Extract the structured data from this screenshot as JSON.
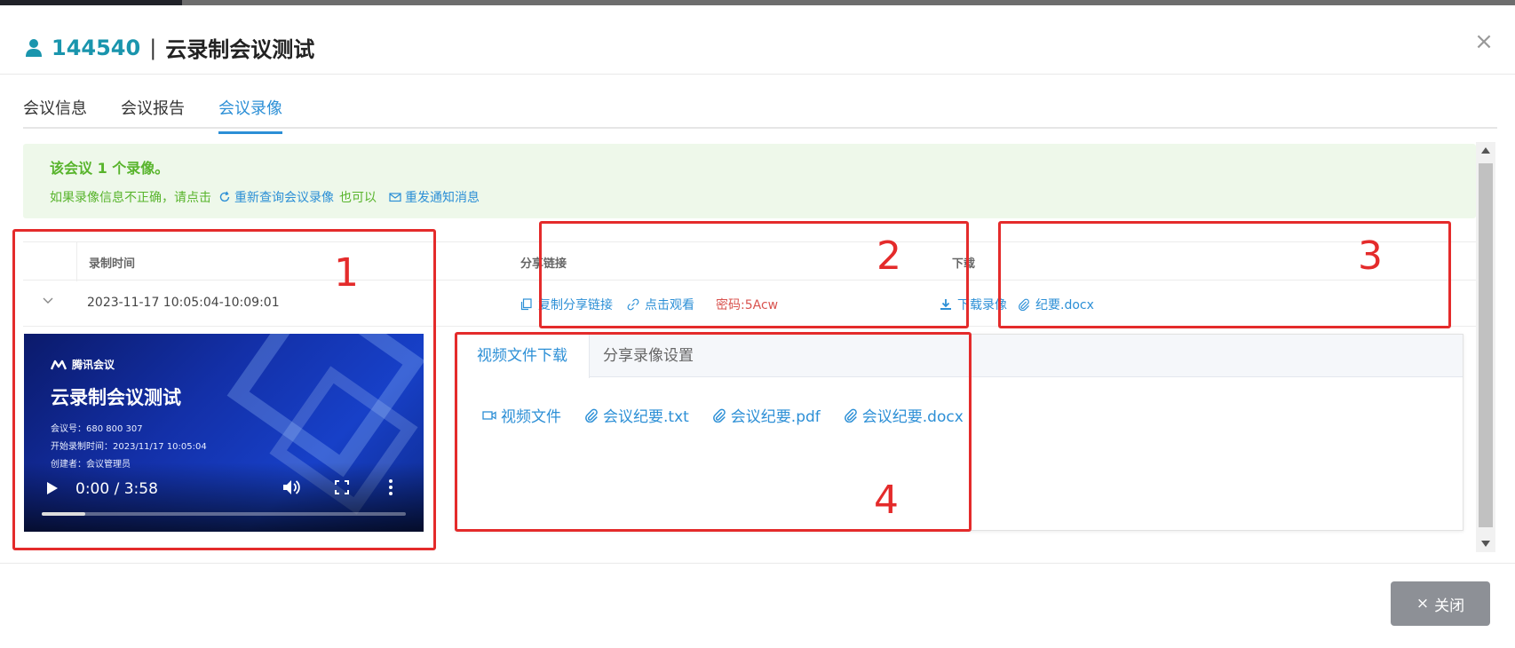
{
  "header": {
    "meeting_id": "144540",
    "separator": "|",
    "meeting_name": "云录制会议测试",
    "close_symbol": "×"
  },
  "tabs": [
    {
      "label": "会议信息",
      "active": false
    },
    {
      "label": "会议报告",
      "active": false
    },
    {
      "label": "会议录像",
      "active": true
    }
  ],
  "alert": {
    "title": "该会议 1 个录像。",
    "hint_prefix": "如果录像信息不正确，请点击",
    "requery_label": "重新查询会议录像",
    "hint_middle": "也可以",
    "resend_label": "重发通知消息"
  },
  "table": {
    "columns": [
      "录制时间",
      "分享链接",
      "下载"
    ],
    "row": {
      "time_range": "2023-11-17 10:05:04-10:09:01",
      "copy_link_label": "复制分享链接",
      "watch_label": "点击观看",
      "password_text": "密码:5Acw",
      "download_label": "下载录像",
      "minutes_doc_label": "纪要.docx"
    }
  },
  "video": {
    "brand": "腾讯会议",
    "title": "云录制会议测试",
    "meeting_no": "会议号：680 800 307",
    "start_time": "开始录制时间：2023/11/17 10:05:04",
    "creator": "创建者：会议管理员",
    "time_display": "0:00 / 3:58",
    "progress": 0.12
  },
  "subpanel": {
    "tabs": [
      {
        "label": "视频文件下载",
        "active": true
      },
      {
        "label": "分享录像设置",
        "active": false
      }
    ],
    "files": [
      "视频文件",
      "会议纪要.txt",
      "会议纪要.pdf",
      "会议纪要.docx"
    ]
  },
  "annotations": [
    "1",
    "2",
    "3",
    "4"
  ],
  "footer": {
    "close_label": "关闭",
    "close_symbol": "×"
  },
  "colors": {
    "accent": "#2c8fd6",
    "meeting_id": "#1a95ad",
    "success": "#58b42c",
    "annotation_red": "#e42b2b",
    "close_button": "#8d9096"
  }
}
